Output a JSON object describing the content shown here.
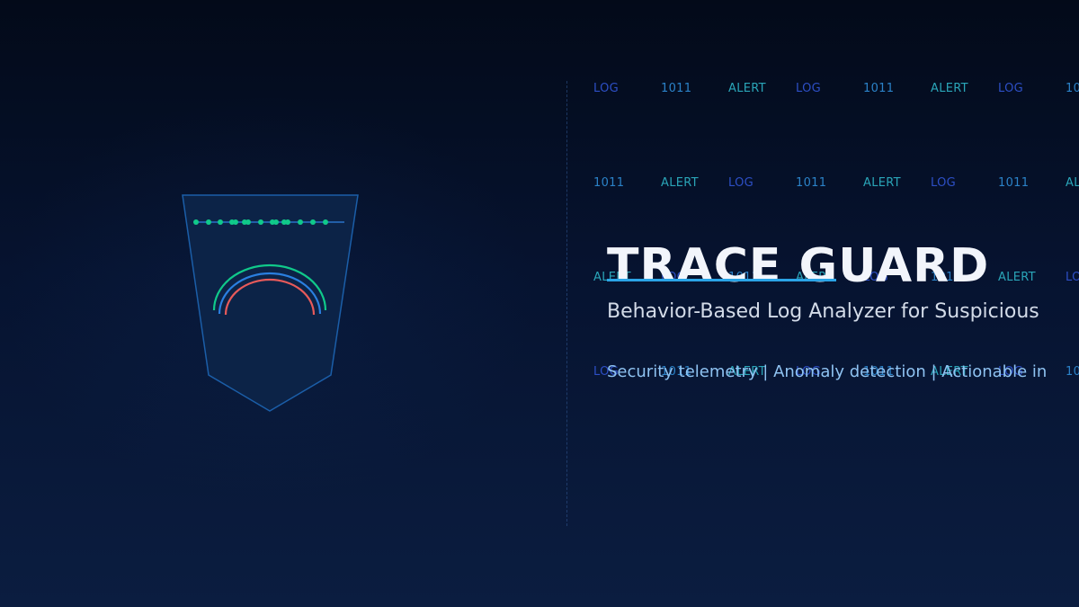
{
  "banner": {
    "title": "TRACE GUARD",
    "subtitle": "Behavior-Based Log Analyzer for Suspicious",
    "tagline": "Security telemetry | Anomaly detection | Actionable in"
  },
  "log_stream": {
    "rows": [
      [
        "LOG",
        "1011",
        "ALERT",
        "LOG",
        "1011",
        "ALERT",
        "LOG",
        "10"
      ],
      [
        "1011",
        "ALERT",
        "LOG",
        "1011",
        "ALERT",
        "LOG",
        "1011",
        "AL"
      ],
      [
        "ALERT",
        "LOG",
        "1011",
        "ALERT",
        "LOG",
        "1011",
        "ALERT",
        "LO"
      ],
      [
        "LOG",
        "1011",
        "ALERT",
        "LOG",
        "1011",
        "ALERT",
        "LOG",
        "10"
      ]
    ]
  },
  "colors": {
    "background_top": "#030a19",
    "background_bottom": "#0b1d40",
    "accent_blue": "#2ba4e6",
    "accent_green": "#10c98a",
    "accent_red": "#e85a5a",
    "shield_fill": "#0c2347",
    "shield_stroke": "#1b5ea8"
  },
  "icons": {
    "shield": "shield-icon",
    "signal_arcs": "signal-arcs-icon",
    "log_dots": "log-dots-icon"
  }
}
